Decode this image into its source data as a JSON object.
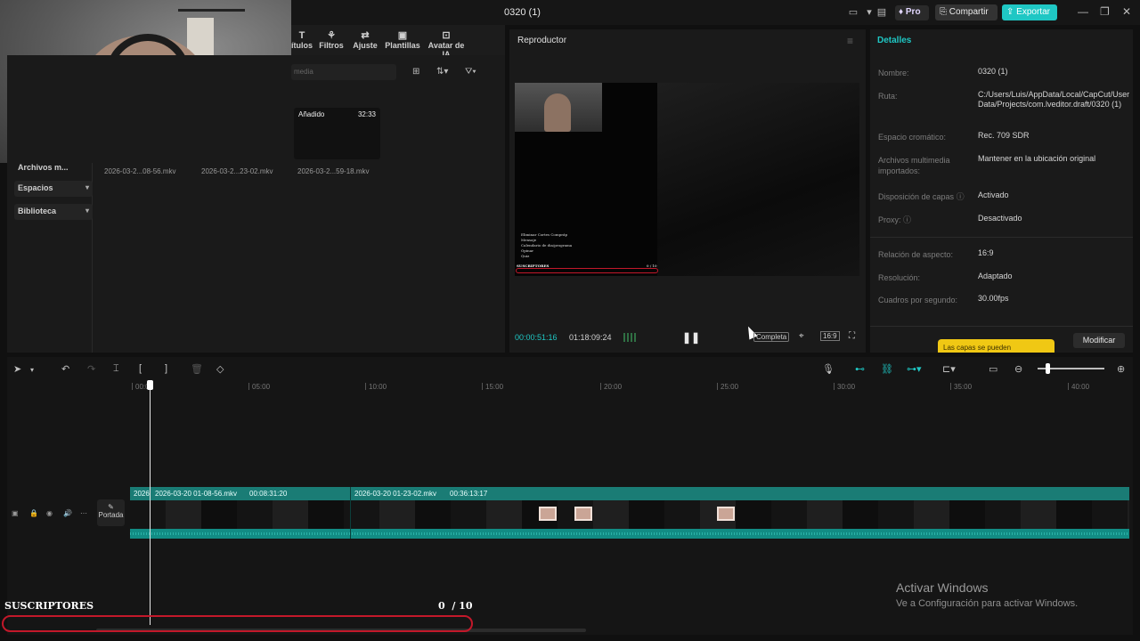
{
  "window": {
    "title": "0320 (1)",
    "pro_label": "Pro",
    "share_label": "Compartir",
    "export_label": "Exportar"
  },
  "toolbar": {
    "tabs": [
      {
        "label": "ítulos",
        "icon": "text-icon"
      },
      {
        "label": "Filtros",
        "icon": "filters-icon"
      },
      {
        "label": "Ajuste",
        "icon": "sliders-icon"
      },
      {
        "label": "Plantillas",
        "icon": "templates-icon"
      },
      {
        "label": "Avatar de IA",
        "icon": "avatar-icon"
      }
    ]
  },
  "media": {
    "search_placeholder": "media",
    "sidebar": [
      {
        "label": "Archivos m..."
      },
      {
        "label": "Espacios"
      },
      {
        "label": "Biblioteca"
      }
    ],
    "clips": [
      {
        "name": "2026-03-2...08-56.mkv"
      },
      {
        "name": "2026-03-2...23-02.mkv"
      },
      {
        "name": "2026-03-2...59-18.mkv",
        "tag": "Añadido",
        "duration": "32:33"
      }
    ]
  },
  "player": {
    "title": "Reproductor",
    "current_time": "00:00:51:16",
    "total_time": "01:18:09:24",
    "quality_label": "Completa",
    "ratio_label": "16:9",
    "video_overlay": {
      "lines": [
        "Eliminar Cortes Compráp",
        "Mensaje",
        "Calendario de dia/programa",
        "Opinar",
        "Quiz"
      ],
      "subs_label": "SUSCRIPTORES",
      "count": "0 / 10"
    }
  },
  "details": {
    "title": "Detalles",
    "rows": [
      {
        "label": "Nombre:",
        "value": "0320 (1)"
      },
      {
        "label": "Ruta:",
        "value": "C:/Users/Luis/AppData/Local/CapCut/User Data/Projects/com.lveditor.draft/0320 (1)"
      },
      {
        "label": "Espacio cromático:",
        "value": "Rec. 709 SDR"
      },
      {
        "label": "Archivos multimedia importados:",
        "value": "Mantener en la ubicación original"
      },
      {
        "label": "Disposición de capas",
        "value": "Activado"
      },
      {
        "label": "Proxy:",
        "value": "Desactivado"
      },
      {
        "label": "Relación de aspecto:",
        "value": "16:9"
      },
      {
        "label": "Resolución:",
        "value": "Adaptado"
      },
      {
        "label": "Cuadros por segundo:",
        "value": "30.00fps"
      }
    ],
    "tooltip": "Las capas se pueden",
    "modify_label": "Modificar"
  },
  "timeline": {
    "ruler": [
      "00:00",
      "05:00",
      "10:00",
      "15:00",
      "20:00",
      "25:00",
      "30:00",
      "35:00",
      "40:00"
    ],
    "cover_label": "Portada",
    "clip1": {
      "start_label": "2026",
      "name": "2026-03-20 01-08-56.mkv",
      "duration": "00:08:31:20"
    },
    "clip2": {
      "name": "2026-03-20 01-23-02.mkv",
      "duration": "00:36:13:17"
    },
    "zoom_level": 0.15
  },
  "overlay": {
    "subs_label": "SUSCRIPTORES",
    "count": "0",
    "total": "/ 10"
  },
  "windows_notice": {
    "title": "Activar Windows",
    "subtitle": "Ve a Configuración para activar Windows."
  }
}
